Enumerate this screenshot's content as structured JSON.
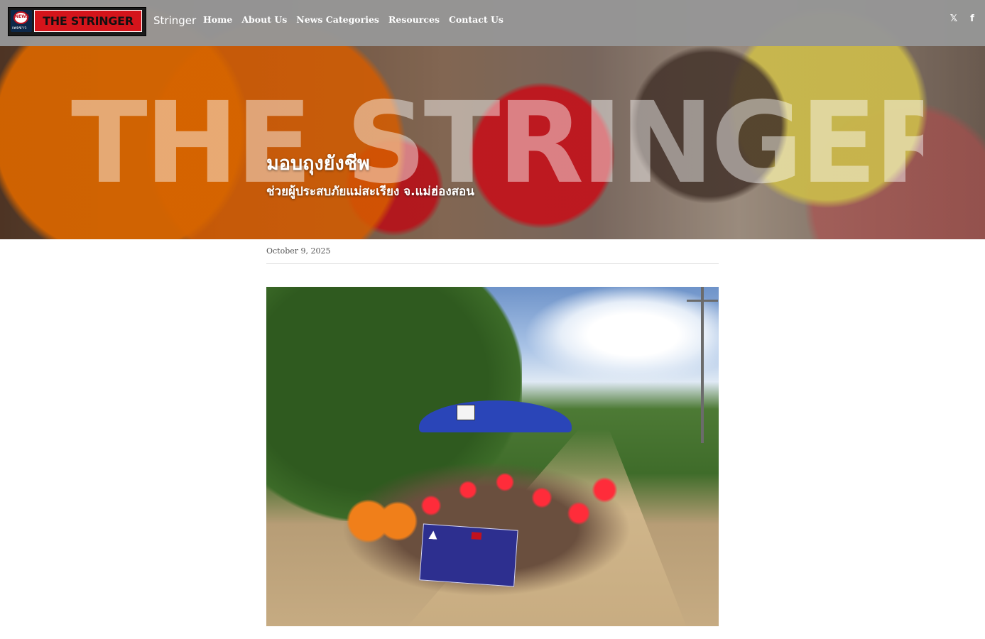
{
  "header": {
    "logo": {
      "text": "THE STRINGER",
      "badge_label": "NEWS",
      "badge_sub": "เพจข่าว"
    },
    "site_name": "Stringer",
    "nav": [
      {
        "label": "Home"
      },
      {
        "label": "About Us"
      },
      {
        "label": "News Categories"
      },
      {
        "label": "Resources"
      },
      {
        "label": "Contact Us"
      }
    ],
    "social": [
      {
        "icon": "x-icon",
        "glyph": "𝕏"
      },
      {
        "icon": "facebook-icon",
        "glyph": "f"
      }
    ]
  },
  "hero": {
    "watermark": "THE STRINGER",
    "title": "มอบถุงยังชีพ",
    "subtitle": "ช่วยผู้ประสบภัยแม่สะเรียง จ.แม่ฮ่องสอน"
  },
  "article": {
    "date": "October 9, 2025"
  },
  "colors": {
    "header_bg": "#969696",
    "logo_red": "#d4141b",
    "text_white": "#ffffff",
    "date_gray": "#555555"
  }
}
